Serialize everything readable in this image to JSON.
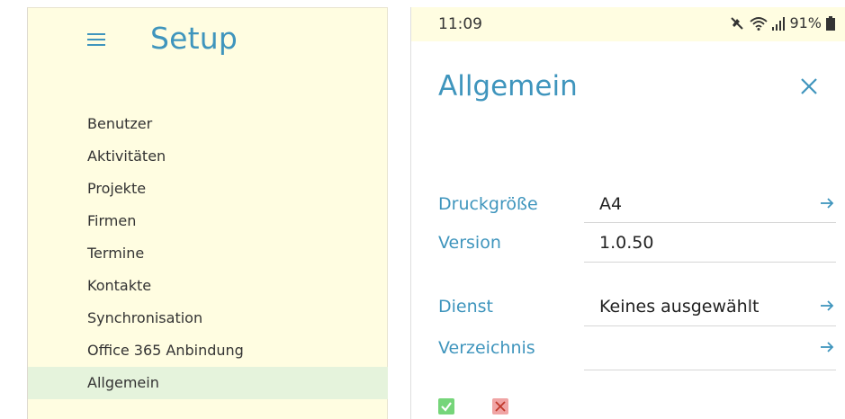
{
  "setup_panel": {
    "title": "Setup",
    "menu_icon": "hamburger-menu-icon",
    "items": [
      {
        "label": "Benutzer"
      },
      {
        "label": "Aktivitäten"
      },
      {
        "label": "Projekte"
      },
      {
        "label": "Firmen"
      },
      {
        "label": "Termine"
      },
      {
        "label": "Kontakte"
      },
      {
        "label": "Synchronisation"
      },
      {
        "label": "Office 365 Anbindung"
      },
      {
        "label": "Allgemein",
        "active": true
      }
    ]
  },
  "status_bar": {
    "time": "11:09",
    "battery": "91%",
    "icons": [
      "mute-icon",
      "wifi-icon",
      "signal-icon",
      "battery-icon"
    ]
  },
  "detail_panel": {
    "title": "Allgemein",
    "close_icon": "close-icon",
    "rows": [
      {
        "label": "Druckgröße",
        "value": "A4",
        "has_arrow": true
      },
      {
        "label": "Version",
        "value": "1.0.50",
        "has_arrow": false
      },
      {
        "label": "Dienst",
        "value": "Keines ausgewählt",
        "has_arrow": true
      },
      {
        "label": "Verzeichnis",
        "value": "",
        "has_arrow": true
      }
    ]
  },
  "footer": {
    "confirm_icon": "check-icon",
    "cancel_icon": "cross-icon"
  },
  "colors": {
    "accent": "#3f95bd",
    "panel_bg": "#fffde1",
    "active_bg": "#e5f3dc",
    "confirm": "#76d57a",
    "cancel": "#f0a4a4"
  }
}
